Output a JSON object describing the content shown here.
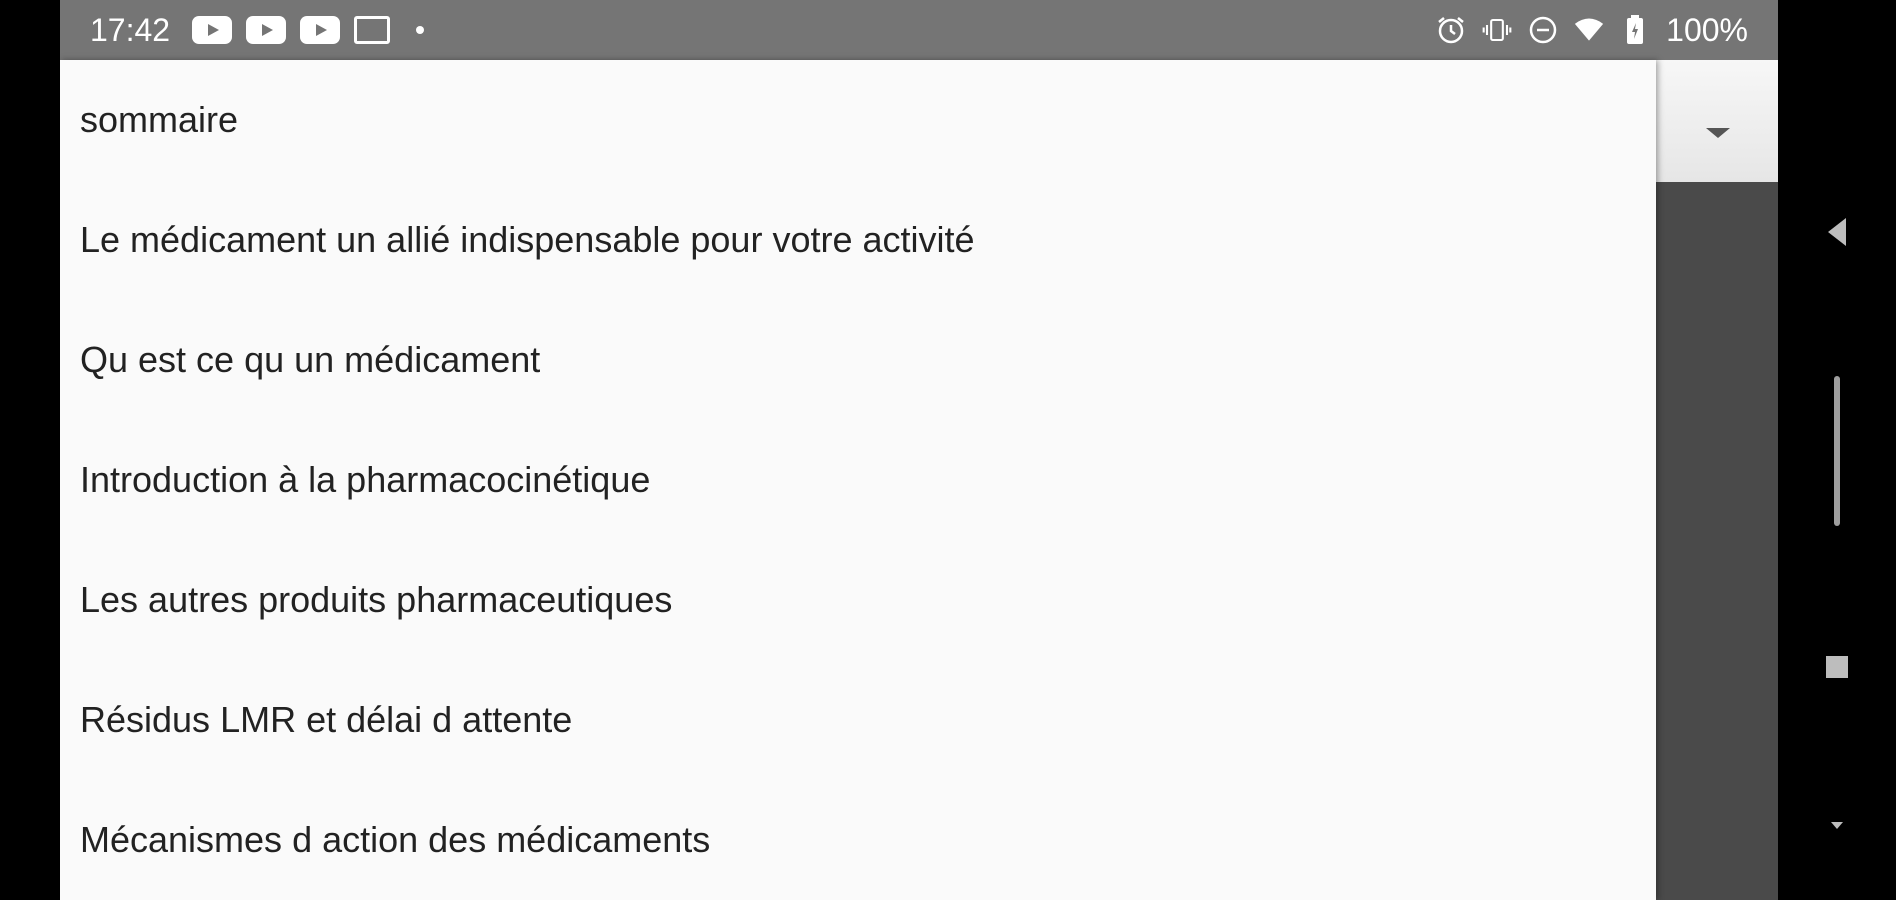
{
  "status_bar": {
    "time": "17:42",
    "notification_icons": [
      "youtube-icon",
      "youtube-icon",
      "youtube-icon",
      "gmail-icon"
    ],
    "right_icons": [
      "alarm-icon",
      "vibrate-icon",
      "do-not-disturb-icon",
      "wifi-icon",
      "battery-icon"
    ],
    "battery": "100%"
  },
  "dropdown": {
    "items": [
      {
        "label": "sommaire"
      },
      {
        "label": "Le médicament un allié indispensable pour votre activité"
      },
      {
        "label": "Qu est ce qu un médicament"
      },
      {
        "label": "Introduction à la pharmacocinétique"
      },
      {
        "label": "Les autres produits pharmaceutiques"
      },
      {
        "label": "Résidus LMR et délai d attente"
      },
      {
        "label": "Mécanismes d action des médicaments"
      }
    ]
  },
  "colors": {
    "status_bar": "#757575",
    "popup_bg": "#fafafa",
    "text": "#222222",
    "background_dark": "#4a4a4a"
  }
}
